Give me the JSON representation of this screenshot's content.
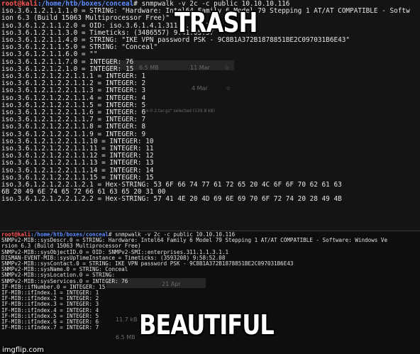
{
  "meme": {
    "top_caption": "TRASH",
    "bottom_caption": "BEAUTIFUL",
    "watermark": "imgflip.com"
  },
  "top_terminal": {
    "prompt_user": "root@kali",
    "prompt_path": ":/home/htb/boxes/conceal",
    "prompt_symbol": "#",
    "command": " snmpwalk -v 2c -c public 10.10.10.116",
    "lines": [
      "iso.3.6.1.2.1.1.1.0 = STRING: \"Hardware: Intel64 Family 6 Model 79 Stepping 1 AT/AT COMPATIBLE - Softw",
      "ion 6.3 (Build 15063 Multiprocessor Free)\"",
      "iso.3.6.1.2.1.1.2.0 = OID: iso.3.6.1.4.1.311.1.1.3.1.1",
      "iso.3.6.1.2.1.1.3.0 = Timeticks: (3486557) 9:41:05.57",
      "iso.3.6.1.2.1.1.4.0 = STRING: \"IKE VPN password PSK - 9C8B1A372B1878851BE2C097031B6E43\"",
      "iso.3.6.1.2.1.1.5.0 = STRING: \"Conceal\"",
      "iso.3.6.1.2.1.1.6.0 = \"\"",
      "iso.3.6.1.2.1.1.7.0 = INTEGER: 76",
      "iso.3.6.1.2.1.2.1.0 = INTEGER: 15",
      "iso.3.6.1.2.1.2.2.1.1.1 = INTEGER: 1",
      "iso.3.6.1.2.1.2.2.1.1.2 = INTEGER: 2",
      "iso.3.6.1.2.1.2.2.1.1.3 = INTEGER: 3",
      "iso.3.6.1.2.1.2.2.1.1.4 = INTEGER: 4",
      "iso.3.6.1.2.1.2.2.1.1.5 = INTEGER: 5",
      "iso.3.6.1.2.1.2.2.1.1.6 = INTEGER: 6",
      "iso.3.6.1.2.1.2.2.1.1.7 = INTEGER: 7",
      "iso.3.6.1.2.1.2.2.1.1.8 = INTEGER: 8",
      "iso.3.6.1.2.1.2.2.1.1.9 = INTEGER: 9",
      "iso.3.6.1.2.1.2.2.1.1.10 = INTEGER: 10",
      "iso.3.6.1.2.1.2.2.1.1.11 = INTEGER: 11",
      "iso.3.6.1.2.1.2.2.1.1.12 = INTEGER: 12",
      "iso.3.6.1.2.1.2.2.1.1.13 = INTEGER: 13",
      "iso.3.6.1.2.1.2.2.1.1.14 = INTEGER: 14",
      "iso.3.6.1.2.1.2.2.1.1.15 = INTEGER: 15",
      "iso.3.6.1.2.1.2.2.1.2.1 = Hex-STRING: 53 6F 66 74 77 61 72 65 20 4C 6F 6F 70 62 61 63",
      "6B 20 49 6E 74 65 72 66 61 63 65 20 31 00",
      "iso.3.6.1.2.1.2.2.1.2.2 = Hex-STRING: 57 41 4E 20 4D 69 6E 69 70 6F 72 74 20 28 49 4B"
    ]
  },
  "bottom_terminal": {
    "prompt_user": "root@kali",
    "prompt_path": ":/home/htb/boxes/conceal",
    "prompt_symbol": "#",
    "command": " snmpwalk -v 2c -c public 10.10.10.116",
    "lines": [
      "SNMPv2-MIB::sysDescr.0 = STRING: Hardware: Intel64 Family 6 Model 79 Stepping 1 AT/AT COMPATIBLE - Software: Windows Ve",
      "rsion 6.3 (Build 15063 Multiprocessor Free)",
      "SNMPv2-MIB::sysObjectID.0 = OID: SNMPv2-SMI::enterprises.311.1.1.3.1.1",
      "DISMAN-EVENT-MIB::sysUpTimeInstance = Timeticks: (3593208) 9:58:52.08",
      "SNMPv2-MIB::sysContact.0 = STRING: IKE VPN password PSK - 9C8B1A372B1878851BE2C097031B6E43",
      "SNMPv2-MIB::sysName.0 = STRING: Conceal",
      "SNMPv2-MIB::sysLocation.0 = STRING:",
      "SNMPv2-MIB::sysServices.0 = INTEGER: 76",
      "IF-MIB::ifNumber.0 = INTEGER: 15",
      "IF-MIB::ifIndex.1 = INTEGER: 1",
      "IF-MIB::ifIndex.2 = INTEGER: 2",
      "IF-MIB::ifIndex.3 = INTEGER: 3",
      "IF-MIB::ifIndex.4 = INTEGER: 4",
      "IF-MIB::ifIndex.5 = INTEGER: 5",
      "IF-MIB::ifIndex.6 = INTEGER: 6",
      "IF-MIB::ifIndex.7 = INTEGER: 7"
    ]
  },
  "background_ghost": {
    "top_size": "6.5 MB",
    "top_date_1": "11 Mar",
    "top_date_2": "4 Mar",
    "top_selected": "\"sx-0.2.tar.gz\" selected (139.8 kB)",
    "bottom_date": "21 Apr",
    "bottom_size_1": "11.7 kB",
    "bottom_size_2": "6.5 MB"
  }
}
